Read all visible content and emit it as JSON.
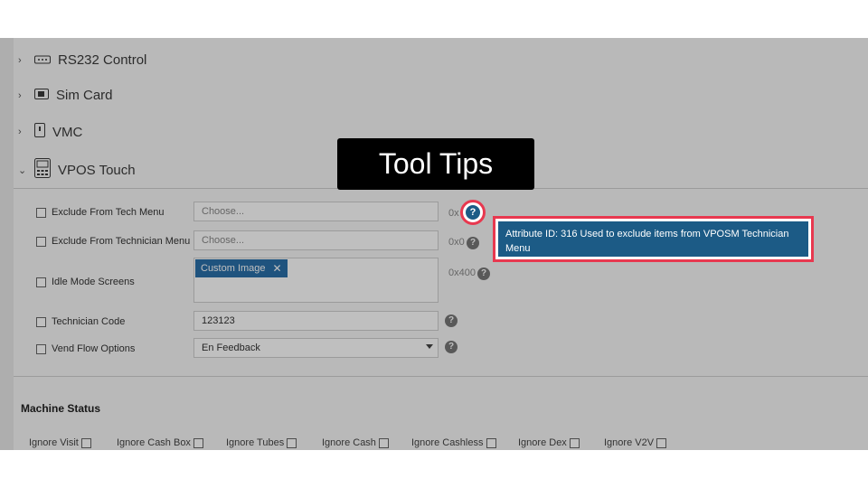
{
  "nav_sections": [
    {
      "label": "RS232 Control",
      "icon": "serial-port-icon",
      "chevron": "›"
    },
    {
      "label": "Sim Card",
      "icon": "sim-card-icon",
      "chevron": "›"
    },
    {
      "label": "VMC",
      "icon": "vmc-device-icon",
      "chevron": "›"
    },
    {
      "label": "VPOS Touch",
      "icon": "vpos-terminal-icon",
      "chevron": "⌄"
    }
  ],
  "fields": {
    "exclude_tech_menu": {
      "label": "Exclude From Tech Menu",
      "placeholder": "Choose...",
      "hex": "0x"
    },
    "exclude_technician_menu": {
      "label": "Exclude From Technician Menu",
      "placeholder": "Choose...",
      "hex": "0x0"
    },
    "idle_mode_screens": {
      "label": "Idle Mode Screens",
      "tag": "Custom Image",
      "tag_remove": "✕",
      "hex": "0x400"
    },
    "technician_code": {
      "label": "Technician Code",
      "value": "123123"
    },
    "vend_flow_options": {
      "label": "Vend Flow Options",
      "value": "En Feedback"
    }
  },
  "help_icon_glyph": "?",
  "banner": {
    "text": "Tool Tips"
  },
  "tooltip": {
    "text": "Attribute ID: 316 Used to exclude items from VPOSM Technician Menu"
  },
  "machine_status": {
    "title": "Machine Status",
    "items": [
      "Ignore Visit",
      "Ignore Cash Box",
      "Ignore Tubes",
      "Ignore Cash",
      "Ignore Cashless",
      "Ignore Dex",
      "Ignore V2V"
    ]
  },
  "colors": {
    "highlight": "#e8384f",
    "tooltip_bg": "#1c5b86",
    "tag_bg": "#2a6fa8"
  }
}
